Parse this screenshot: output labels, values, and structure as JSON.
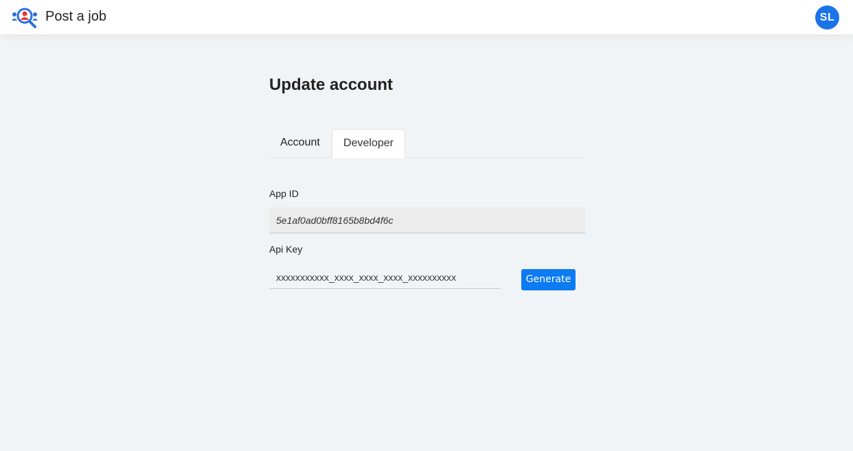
{
  "header": {
    "brand_label": "Post a job",
    "logo_icon": "people-search-icon",
    "avatar_initials": "SL",
    "avatar_color": "#1a73e8"
  },
  "page": {
    "title": "Update account"
  },
  "tabs": [
    {
      "label": "Account",
      "active": false
    },
    {
      "label": "Developer",
      "active": true
    }
  ],
  "developer": {
    "app_id_label": "App ID",
    "app_id_value": "5e1af0ad0bff8165b8bd4f6c",
    "api_key_label": "Api Key",
    "api_key_value": "xxxxxxxxxxx_xxxx_xxxx_xxxx_xxxxxxxxxx",
    "generate_label": "Generate"
  },
  "colors": {
    "accent": "#0d7bf2",
    "background": "#f1f4f7"
  }
}
